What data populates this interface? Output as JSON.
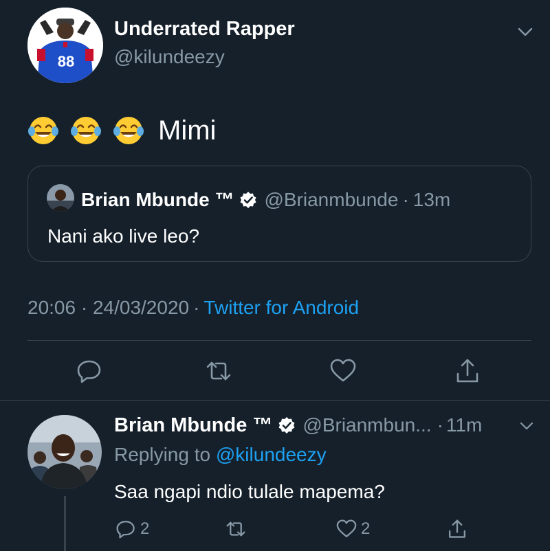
{
  "colors": {
    "background": "#15202b",
    "primary_text": "#ffffff",
    "secondary_text": "#8899a6",
    "link": "#1da1f2",
    "border": "#38444d"
  },
  "main_tweet": {
    "display_name": "Underrated Rapper",
    "handle": "@kilundeezy",
    "avatar_jersey_number": "88",
    "emoji": [
      "face-with-tears-of-joy-icon",
      "face-with-tears-of-joy-icon",
      "face-with-tears-of-joy-icon"
    ],
    "text": "Mimi",
    "quoted_tweet": {
      "display_name": "Brian Mbunde ™",
      "verified": true,
      "handle": "@Brianmbunde",
      "separator": "·",
      "time": "13m",
      "text": "Nani ako live leo?"
    },
    "timestamp": "20:06 · 24/03/2020",
    "separator": "·",
    "client": "Twitter for Android",
    "actions": [
      "reply-icon",
      "retweet-icon",
      "like-icon",
      "share-icon"
    ]
  },
  "reply_tweet": {
    "display_name": "Brian Mbunde ™",
    "verified": true,
    "handle": "@Brianmbun...",
    "separator": "·",
    "time": "11m",
    "replying_to_label": "Replying to",
    "replying_to_handle": "@kilundeezy",
    "text": "Saa ngapi ndio tulale mapema?",
    "reply_count": "2",
    "like_count": "2"
  }
}
